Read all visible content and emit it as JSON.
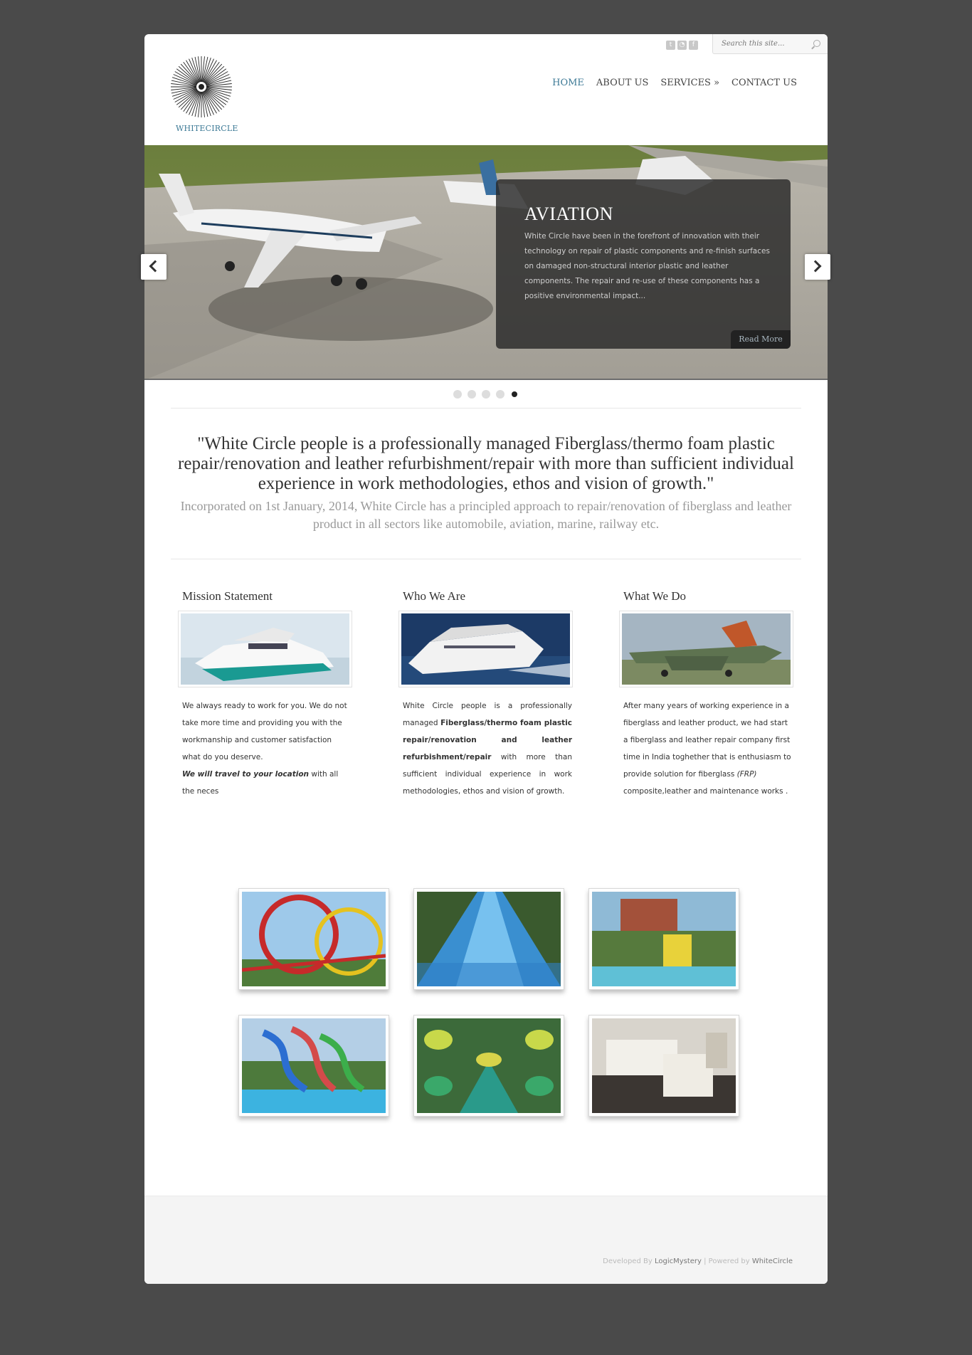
{
  "header": {
    "logo_text": "WHITECIRCLE",
    "search_placeholder": "Search this site...",
    "social_icons": [
      "twitter-icon",
      "rss-icon",
      "facebook-icon"
    ],
    "nav": [
      {
        "label": "HOME",
        "active": true
      },
      {
        "label": "ABOUT US",
        "active": false
      },
      {
        "label": "SERVICES »",
        "active": false
      },
      {
        "label": "CONTACT US",
        "active": false
      }
    ]
  },
  "slider": {
    "title": "AVIATION",
    "text": "White Circle have been in the forefront of innovation with their technology on repair of plastic components and re-finish surfaces on damaged non-structural interior plastic and leather components. The repair and re-use of these components has a positive environmental impact...",
    "read_more": "Read More",
    "dots_total": 5,
    "active_dot": 5
  },
  "intro": {
    "quote": "\"White Circle people is a professionally managed Fiberglass/thermo foam plastic repair/renovation and leather refurbishment/repair with more than sufficient individual experience in work methodologies, ethos and vision of growth.\"",
    "sub": "Incorporated on 1st January, 2014, White Circle has a principled approach to repair/renovation of fiberglass and leather product in all sectors like automobile, aviation, marine, railway etc."
  },
  "columns": {
    "mission": {
      "title": "Mission Statement",
      "text1": "We always ready to work for you. We do not take more time and providing you with the workmanship and customer satisfaction what do you deserve.",
      "text_bold": "We will travel to your location",
      "text2": " with all the neces"
    },
    "who": {
      "title": "Who We Are",
      "t1": "White Circle people is a professionally managed ",
      "bold": "Fiberglass/thermo foam plastic repair/renovation and leather refurbishment/repair",
      "t2": " with more than sufficient individual experience in work methodologies, ethos and vision of growth."
    },
    "what": {
      "title": "What We Do",
      "t1": "After many years of working experience in a fiberglass and leather product, we had start a fiberglass and leather repair company first time in India toghether that is enthusiasm to provide solution for fiberglass ",
      "italic": "(FRP)",
      "t2": " composite,leather and maintenance works ."
    }
  },
  "footer": {
    "prefix": "Developed By ",
    "developer": "LogicMystery",
    "sep": " | Powered by ",
    "powered": "WhiteCircle"
  }
}
